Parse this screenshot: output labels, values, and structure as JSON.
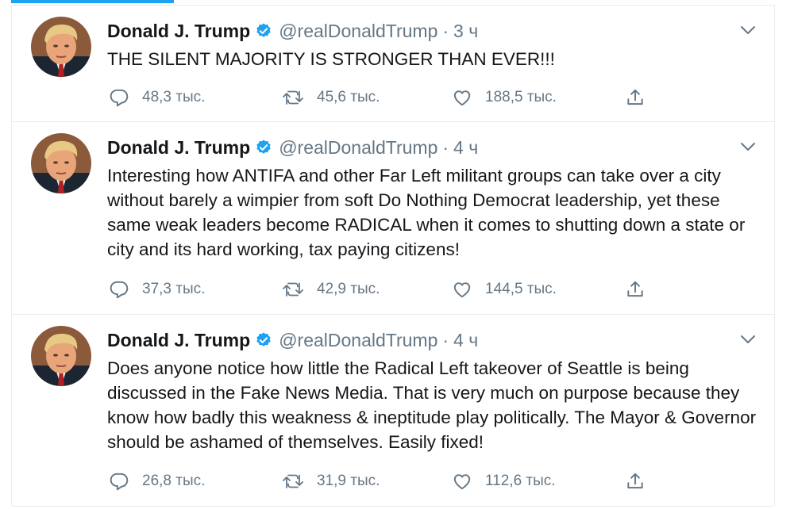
{
  "colors": {
    "accent": "#1da1f2",
    "secondary_text": "#657786",
    "text": "#14171a",
    "divider": "#e6ecf0"
  },
  "tweets": [
    {
      "name": "Donald J. Trump",
      "handle": "@realDonaldTrump",
      "separator": "·",
      "time": "3 ч",
      "text": "THE SILENT MAJORITY IS STRONGER THAN EVER!!!",
      "replies": "48,3 тыс.",
      "retweets": "45,6 тыс.",
      "likes": "188,5 тыс.",
      "icons": [
        "reply-icon",
        "retweet-icon",
        "like-icon",
        "share-icon"
      ]
    },
    {
      "name": "Donald J. Trump",
      "handle": "@realDonaldTrump",
      "separator": "·",
      "time": "4 ч",
      "text": "Interesting how ANTIFA and other Far Left militant groups can take over a city without barely a wimpier from soft Do Nothing Democrat leadership, yet these same weak leaders become RADICAL when it comes to shutting down a state or city and its hard working, tax paying citizens!",
      "replies": "37,3 тыс.",
      "retweets": "42,9 тыс.",
      "likes": "144,5 тыс.",
      "icons": [
        "reply-icon",
        "retweet-icon",
        "like-icon",
        "share-icon"
      ]
    },
    {
      "name": "Donald J. Trump",
      "handle": "@realDonaldTrump",
      "separator": "·",
      "time": "4 ч",
      "text": "Does anyone notice how little the Radical Left takeover of Seattle is being discussed in the Fake News Media. That is very much on purpose because they know how badly this weakness & ineptitude play politically. The Mayor & Governor should be ashamed of themselves. Easily fixed!",
      "replies": "26,8 тыс.",
      "retweets": "31,9 тыс.",
      "likes": "112,6 тыс.",
      "icons": [
        "reply-icon",
        "retweet-icon",
        "like-icon",
        "share-icon"
      ]
    }
  ]
}
